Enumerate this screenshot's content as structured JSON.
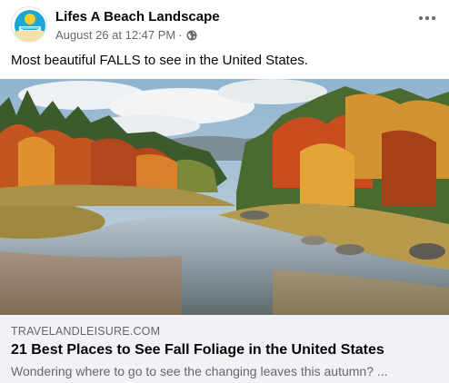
{
  "post": {
    "page_name": "Lifes A Beach Landscape",
    "timestamp": "August 26 at 12:47 PM",
    "separator": "·",
    "privacy_icon": "globe-icon",
    "more_icon": "more-options-icon",
    "caption": "Most beautiful FALLS to see in the United States."
  },
  "link_preview": {
    "domain": "TRAVELANDLEISURE.COM",
    "title": "21 Best Places to See Fall Foliage in the United States",
    "description": "Wondering where to go to see the changing leaves this autumn? ..."
  },
  "colors": {
    "background": "#ffffff",
    "link_footer_bg": "#f0f2f5",
    "secondary_text": "#65676b",
    "primary_text": "#050505"
  }
}
